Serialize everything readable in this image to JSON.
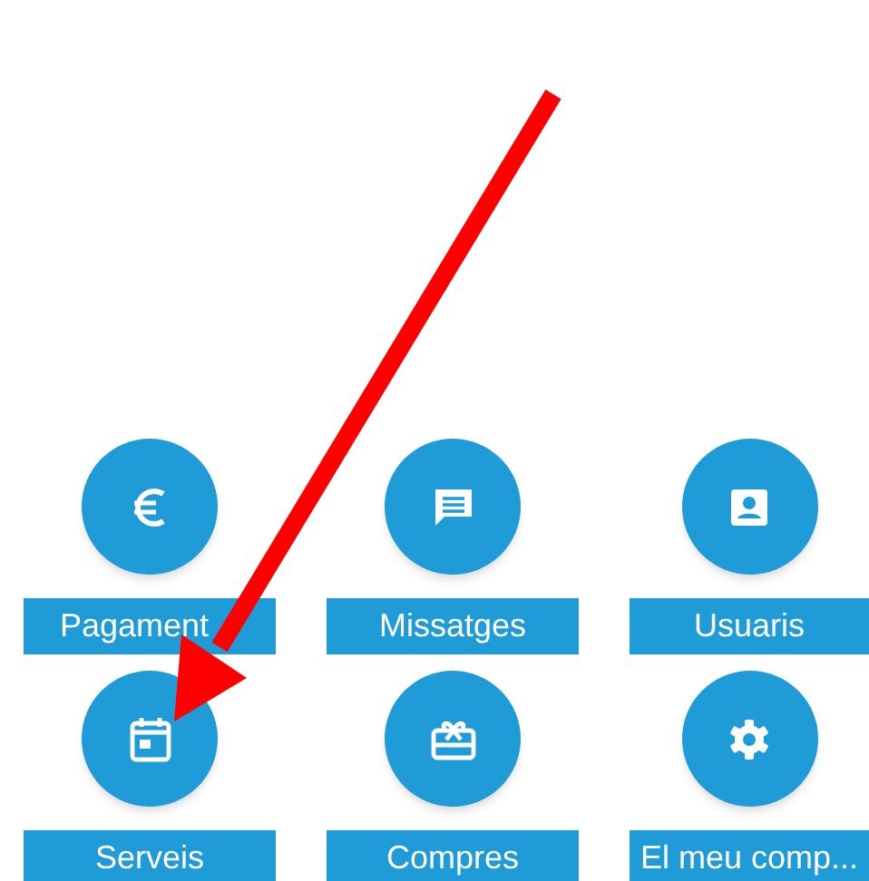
{
  "tiles": [
    {
      "kind": "euro",
      "label": "Pagament"
    },
    {
      "kind": "message",
      "label": "Missatges"
    },
    {
      "kind": "contact",
      "label": "Usuaris"
    },
    {
      "kind": "calendar",
      "label": "Serveis"
    },
    {
      "kind": "gift",
      "label": "Compres"
    },
    {
      "kind": "gear",
      "label": "El meu comp..."
    }
  ]
}
